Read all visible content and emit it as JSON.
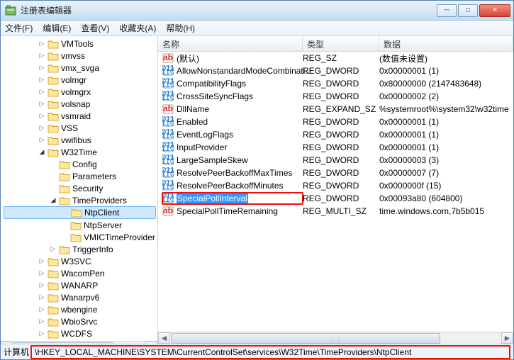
{
  "window": {
    "title": "注册表编辑器"
  },
  "menu": {
    "file": "文件(F)",
    "edit": "编辑(E)",
    "view": "查看(V)",
    "favorites": "收藏夹(A)",
    "help": "帮助(H)"
  },
  "tree": [
    {
      "l": "VMTools",
      "d": 3,
      "e": "c"
    },
    {
      "l": "vmvss",
      "d": 3,
      "e": "c"
    },
    {
      "l": "vmx_svga",
      "d": 3,
      "e": "c"
    },
    {
      "l": "volmgr",
      "d": 3,
      "e": "c"
    },
    {
      "l": "volmgrx",
      "d": 3,
      "e": "c"
    },
    {
      "l": "volsnap",
      "d": 3,
      "e": "c"
    },
    {
      "l": "vsmraid",
      "d": 3,
      "e": "c"
    },
    {
      "l": "VSS",
      "d": 3,
      "e": "c"
    },
    {
      "l": "vwifibus",
      "d": 3,
      "e": "c"
    },
    {
      "l": "W32Time",
      "d": 3,
      "e": "o"
    },
    {
      "l": "Config",
      "d": 4,
      "e": "n"
    },
    {
      "l": "Parameters",
      "d": 4,
      "e": "n"
    },
    {
      "l": "Security",
      "d": 4,
      "e": "n"
    },
    {
      "l": "TimeProviders",
      "d": 4,
      "e": "o"
    },
    {
      "l": "NtpClient",
      "d": 5,
      "e": "n",
      "sel": true
    },
    {
      "l": "NtpServer",
      "d": 5,
      "e": "n"
    },
    {
      "l": "VMICTimeProvider",
      "d": 5,
      "e": "n"
    },
    {
      "l": "TriggerInfo",
      "d": 4,
      "e": "c"
    },
    {
      "l": "W3SVC",
      "d": 3,
      "e": "c"
    },
    {
      "l": "WacomPen",
      "d": 3,
      "e": "c"
    },
    {
      "l": "WANARP",
      "d": 3,
      "e": "c"
    },
    {
      "l": "Wanarpv6",
      "d": 3,
      "e": "c"
    },
    {
      "l": "wbengine",
      "d": 3,
      "e": "c"
    },
    {
      "l": "WbioSrvc",
      "d": 3,
      "e": "c"
    },
    {
      "l": "WCDFS",
      "d": 3,
      "e": "c"
    }
  ],
  "list": {
    "headers": {
      "name": "名称",
      "type": "类型",
      "data": "数据"
    },
    "rows": [
      {
        "icon": "sz",
        "name": "(默认)",
        "type": "REG_SZ",
        "data": "(数值未设置)"
      },
      {
        "icon": "dw",
        "name": "AllowNonstandardModeCombinati...",
        "type": "REG_DWORD",
        "data": "0x00000001 (1)"
      },
      {
        "icon": "dw",
        "name": "CompatibilityFlags",
        "type": "REG_DWORD",
        "data": "0x80000000 (2147483648)"
      },
      {
        "icon": "dw",
        "name": "CrossSiteSyncFlags",
        "type": "REG_DWORD",
        "data": "0x00000002 (2)"
      },
      {
        "icon": "sz",
        "name": "DllName",
        "type": "REG_EXPAND_SZ",
        "data": "%systemroot%\\system32\\w32time"
      },
      {
        "icon": "dw",
        "name": "Enabled",
        "type": "REG_DWORD",
        "data": "0x00000001 (1)"
      },
      {
        "icon": "dw",
        "name": "EventLogFlags",
        "type": "REG_DWORD",
        "data": "0x00000001 (1)"
      },
      {
        "icon": "dw",
        "name": "InputProvider",
        "type": "REG_DWORD",
        "data": "0x00000001 (1)"
      },
      {
        "icon": "dw",
        "name": "LargeSampleSkew",
        "type": "REG_DWORD",
        "data": "0x00000003 (3)"
      },
      {
        "icon": "dw",
        "name": "ResolvePeerBackoffMaxTimes",
        "type": "REG_DWORD",
        "data": "0x00000007 (7)"
      },
      {
        "icon": "dw",
        "name": "ResolvePeerBackoffMinutes",
        "type": "REG_DWORD",
        "data": "0x0000000f (15)"
      },
      {
        "icon": "dw",
        "name": "SpecialPollInterval",
        "type": "REG_DWORD",
        "data": "0x00093a80 (604800)",
        "sel": true,
        "hl": true
      },
      {
        "icon": "sz",
        "name": "SpecialPollTimeRemaining",
        "type": "REG_MULTI_SZ",
        "data": "time.windows.com,7b5b015"
      }
    ]
  },
  "status": {
    "prefix": "计算机",
    "path": "\\HKEY_LOCAL_MACHINE\\SYSTEM\\CurrentControlSet\\services\\W32Time\\TimeProviders\\NtpClient"
  }
}
